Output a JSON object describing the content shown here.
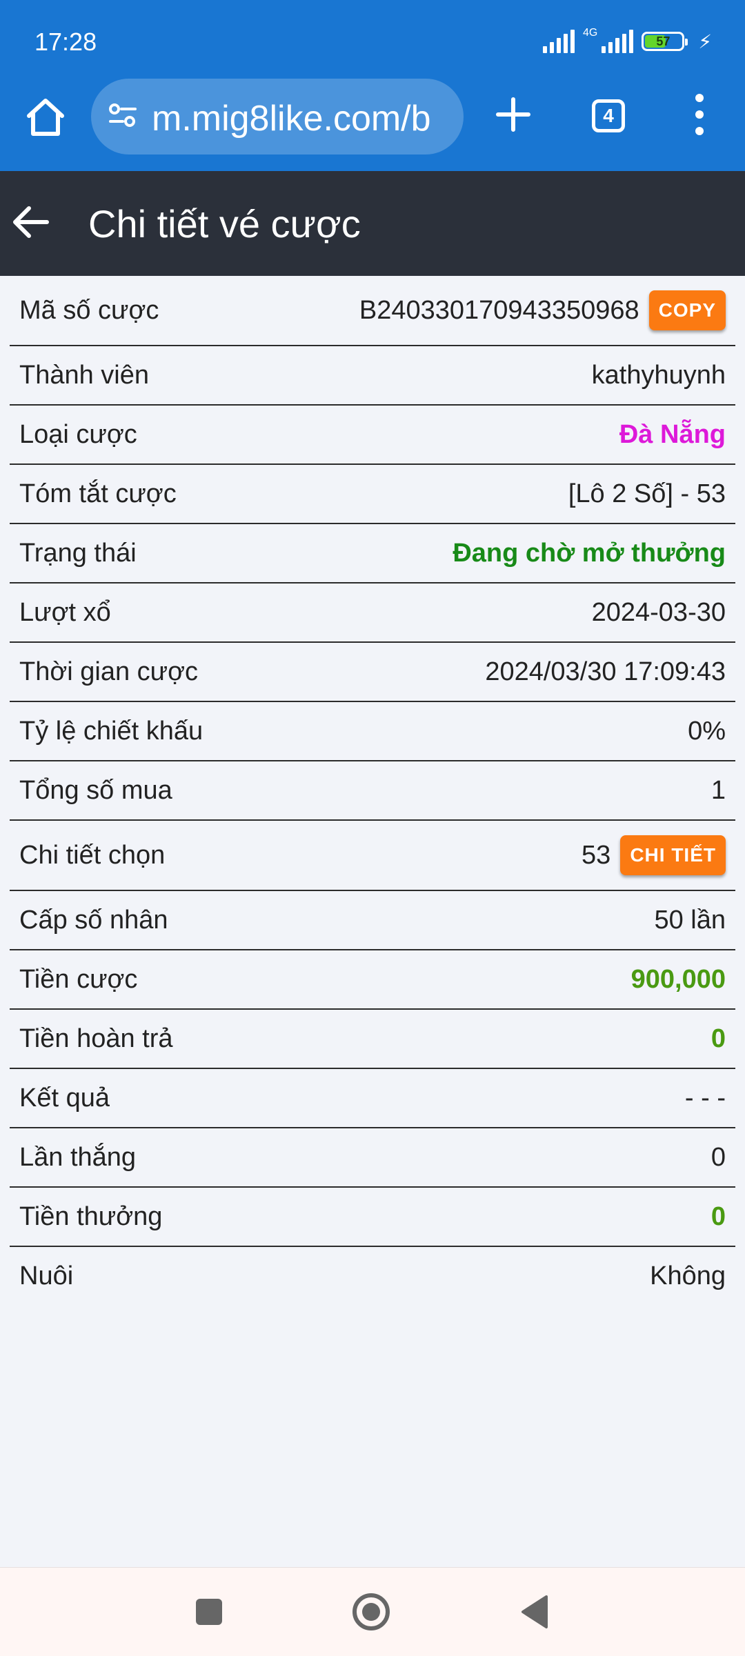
{
  "status_bar": {
    "time": "17:28",
    "network": "4G",
    "battery": "57",
    "battery_level": 0.57
  },
  "browser": {
    "url": "m.mig8like.com/b",
    "tab_count": "4"
  },
  "header": {
    "title": "Chi tiết vé cược"
  },
  "details": {
    "rows": [
      {
        "label": "Mã số cược",
        "value": "B240330170943350968",
        "button": "COPY"
      },
      {
        "label": "Thành viên",
        "value": "kathyhuynh"
      },
      {
        "label": "Loại cược",
        "value": "Đà Nẵng"
      },
      {
        "label": "Tóm tắt cược",
        "value": "[Lô 2 Số] - 53"
      },
      {
        "label": "Trạng thái",
        "value": "Đang chờ mở thưởng"
      },
      {
        "label": "Lượt xổ",
        "value": "2024-03-30"
      },
      {
        "label": "Thời gian cược",
        "value": "2024/03/30 17:09:43"
      },
      {
        "label": "Tỷ lệ chiết khấu",
        "value": "0%"
      },
      {
        "label": "Tổng số mua",
        "value": "1"
      },
      {
        "label": "Chi tiết chọn",
        "value": "53",
        "button": "CHI TIẾT"
      },
      {
        "label": "Cấp số nhân",
        "value": "50 lần"
      },
      {
        "label": "Tiền cược",
        "value": "900,000"
      },
      {
        "label": "Tiền hoàn trả",
        "value": "0"
      },
      {
        "label": "Kết quả",
        "value": "- - -"
      },
      {
        "label": "Lần thắng",
        "value": "0"
      },
      {
        "label": "Tiền thưởng",
        "value": "0"
      },
      {
        "label": "Nuôi",
        "value": "Không"
      }
    ]
  },
  "colors": {
    "browser_bar": "#1976d2",
    "page_header": "#2b303a",
    "button": "#fb7a12",
    "magenta_value": "#dd19d9",
    "green_value": "#188a18",
    "lime_value": "#4a9a12"
  }
}
